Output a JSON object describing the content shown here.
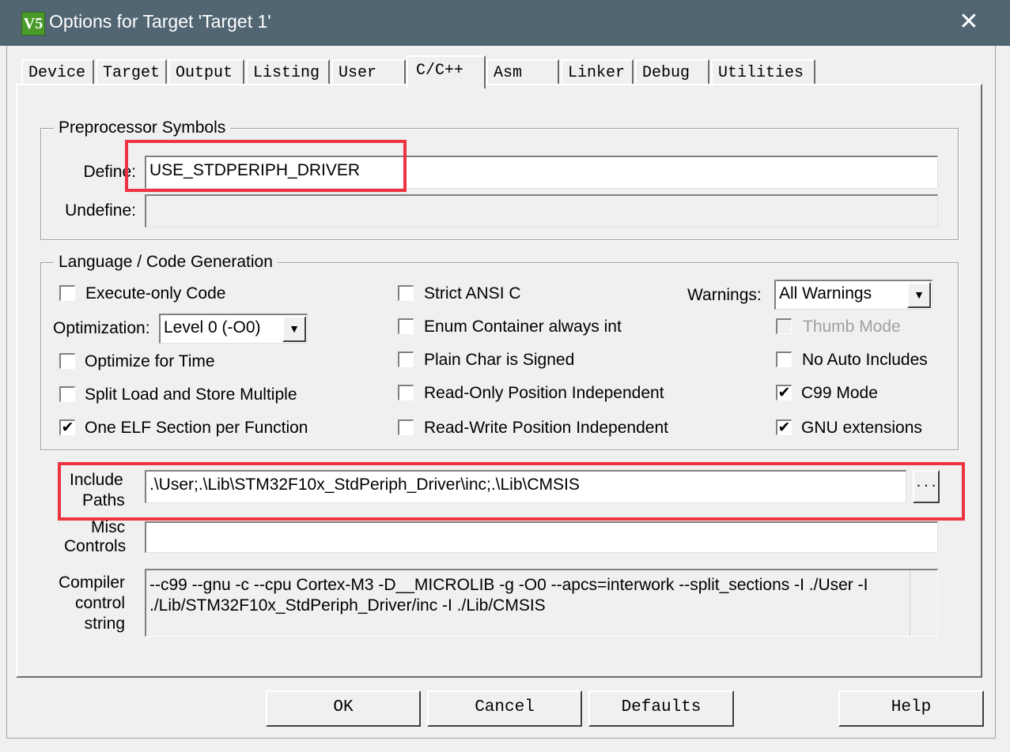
{
  "window": {
    "title": "Options for Target 'Target 1'",
    "icon": "V5",
    "close": "✕"
  },
  "tabs": [
    {
      "label": "Device"
    },
    {
      "label": "Target"
    },
    {
      "label": "Output"
    },
    {
      "label": "Listing"
    },
    {
      "label": "User"
    },
    {
      "label": "C/C++"
    },
    {
      "label": "Asm"
    },
    {
      "label": "Linker"
    },
    {
      "label": "Debug"
    },
    {
      "label": "Utilities"
    }
  ],
  "preprocessor": {
    "legend": "Preprocessor Symbols",
    "define_label": "Define:",
    "define_value": "USE_STDPERIPH_DRIVER",
    "undefine_label": "Undefine:",
    "undefine_value": ""
  },
  "language": {
    "legend": "Language / Code Generation",
    "execute_only": {
      "label": "Execute-only Code",
      "checked": false
    },
    "optimization_label": "Optimization:",
    "optimization_value": "Level 0 (-O0)",
    "optimize_time": {
      "label": "Optimize for Time",
      "checked": false
    },
    "split_load": {
      "label": "Split Load and Store Multiple",
      "checked": false
    },
    "one_elf": {
      "label": "One ELF Section per Function",
      "checked": true
    },
    "strict_ansi": {
      "label": "Strict ANSI C",
      "checked": false
    },
    "enum_container": {
      "label": "Enum Container always int",
      "checked": false
    },
    "plain_char": {
      "label": "Plain Char is Signed",
      "checked": false
    },
    "ropi": {
      "label": "Read-Only Position Independent",
      "checked": false
    },
    "rwpi": {
      "label": "Read-Write Position Independent",
      "checked": false
    },
    "warnings_label": "Warnings:",
    "warnings_value": "All Warnings",
    "thumb_mode": {
      "label": "Thumb Mode",
      "checked": false
    },
    "no_auto_includes": {
      "label": "No Auto Includes",
      "checked": false
    },
    "c99_mode": {
      "label": "C99 Mode",
      "checked": true
    },
    "gnu_extensions": {
      "label": "GNU extensions",
      "checked": true
    }
  },
  "include": {
    "label_line1": "Include",
    "label_line2": "Paths",
    "value": ".\\User;.\\Lib\\STM32F10x_StdPeriph_Driver\\inc;.\\Lib\\CMSIS",
    "browse": "..."
  },
  "misc": {
    "label_line1": "Misc",
    "label_line2": "Controls",
    "value": ""
  },
  "compiler": {
    "label_line1": "Compiler",
    "label_line2": "control",
    "label_line3": "string",
    "line1": "--c99 --gnu -c --cpu Cortex-M3 -D__MICROLIB -g -O0 --apcs=interwork --split_sections -I ./User -I",
    "line2": "./Lib/STM32F10x_StdPeriph_Driver/inc -I ./Lib/CMSIS"
  },
  "buttons": {
    "ok": "OK",
    "cancel": "Cancel",
    "defaults": "Defaults",
    "help": "Help"
  },
  "check_glyph": "✔",
  "dropdown_glyph": "▼",
  "colors": {
    "titlebar": "#526573",
    "highlight_box": "#ee3340"
  }
}
